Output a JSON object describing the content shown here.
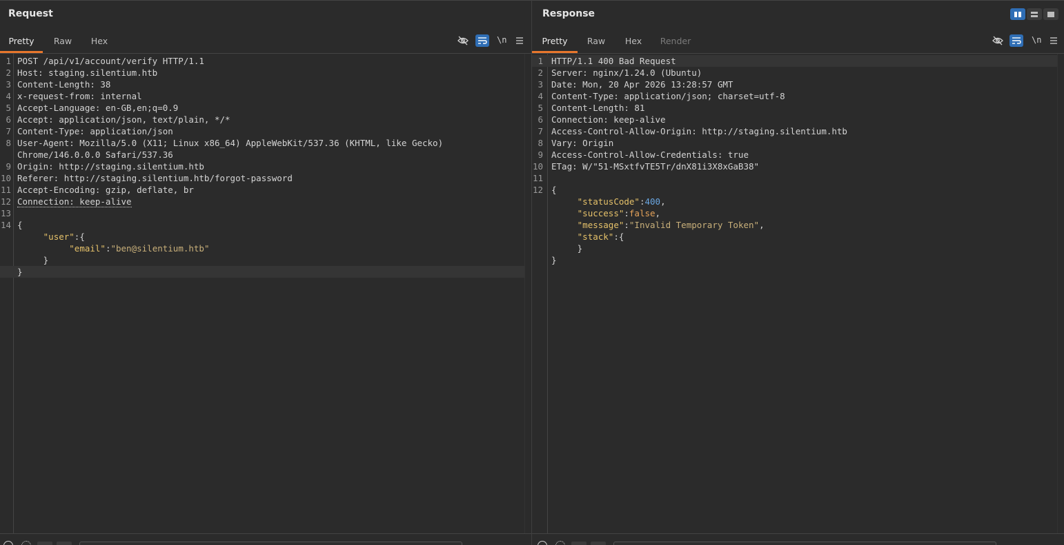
{
  "request": {
    "title": "Request",
    "tabs": [
      {
        "label": "Pretty",
        "active": true
      },
      {
        "label": "Raw",
        "active": false
      },
      {
        "label": "Hex",
        "active": false
      }
    ],
    "newline_label": "\\n",
    "lines": [
      {
        "n": "1",
        "segs": [
          {
            "t": "POST /api/v1/account/verify HTTP/1.1",
            "c": "hk"
          }
        ]
      },
      {
        "n": "2",
        "segs": [
          {
            "t": "Host: staging.silentium.htb",
            "c": "hk"
          }
        ]
      },
      {
        "n": "3",
        "segs": [
          {
            "t": "Content-Length: 38",
            "c": "hk"
          }
        ]
      },
      {
        "n": "4",
        "segs": [
          {
            "t": "x-request-from: internal",
            "c": "hk"
          }
        ]
      },
      {
        "n": "5",
        "segs": [
          {
            "t": "Accept-Language: en-GB,en;q=0.9",
            "c": "hk"
          }
        ]
      },
      {
        "n": "6",
        "segs": [
          {
            "t": "Accept: application/json, text/plain, */*",
            "c": "hk"
          }
        ]
      },
      {
        "n": "7",
        "segs": [
          {
            "t": "Content-Type: application/json",
            "c": "hk"
          }
        ]
      },
      {
        "n": "8",
        "segs": [
          {
            "t": "User-Agent: Mozilla/5.0 (X11; Linux x86_64) AppleWebKit/537.36 (KHTML, like Gecko)",
            "c": "hk"
          }
        ]
      },
      {
        "n": "",
        "segs": [
          {
            "t": "Chrome/146.0.0.0 Safari/537.36",
            "c": "hk"
          }
        ]
      },
      {
        "n": "9",
        "segs": [
          {
            "t": "Origin: http://staging.silentium.htb",
            "c": "hk"
          }
        ]
      },
      {
        "n": "10",
        "segs": [
          {
            "t": "Referer: http://staging.silentium.htb/forgot-password",
            "c": "hk"
          }
        ]
      },
      {
        "n": "11",
        "segs": [
          {
            "t": "Accept-Encoding: gzip, deflate, br",
            "c": "hk"
          }
        ]
      },
      {
        "n": "12",
        "segs": [
          {
            "t": "Connection: keep-alive",
            "c": "hk dotted"
          }
        ]
      },
      {
        "n": "13",
        "segs": []
      },
      {
        "n": "14",
        "segs": [
          {
            "t": "{",
            "c": "hk"
          }
        ]
      },
      {
        "n": "",
        "segs": [
          {
            "t": "     ",
            "c": "hk"
          },
          {
            "t": "\"user\"",
            "c": "jk"
          },
          {
            "t": ":{",
            "c": "hk"
          }
        ]
      },
      {
        "n": "",
        "segs": [
          {
            "t": "          ",
            "c": "hk"
          },
          {
            "t": "\"email\"",
            "c": "jk"
          },
          {
            "t": ":",
            "c": "hk"
          },
          {
            "t": "\"ben@silentium.htb\"",
            "c": "js"
          }
        ]
      },
      {
        "n": "",
        "segs": [
          {
            "t": "     }",
            "c": "hk"
          }
        ]
      },
      {
        "n": "",
        "segs": [
          {
            "t": "}",
            "c": "hk"
          }
        ],
        "hl": true
      }
    ]
  },
  "response": {
    "title": "Response",
    "tabs": [
      {
        "label": "Pretty",
        "active": true
      },
      {
        "label": "Raw",
        "active": false
      },
      {
        "label": "Hex",
        "active": false
      },
      {
        "label": "Render",
        "active": false,
        "disabled": true
      }
    ],
    "newline_label": "\\n",
    "lines": [
      {
        "n": "1",
        "segs": [
          {
            "t": "HTTP/1.1 400 Bad Request",
            "c": "hk"
          }
        ],
        "hl": true
      },
      {
        "n": "2",
        "segs": [
          {
            "t": "Server: nginx/1.24.0 (Ubuntu)",
            "c": "hk"
          }
        ]
      },
      {
        "n": "3",
        "segs": [
          {
            "t": "Date: Mon, 20 Apr 2026 13:28:57 GMT",
            "c": "hk"
          }
        ]
      },
      {
        "n": "4",
        "segs": [
          {
            "t": "Content-Type: application/json; charset=utf-8",
            "c": "hk"
          }
        ]
      },
      {
        "n": "5",
        "segs": [
          {
            "t": "Content-Length: 81",
            "c": "hk"
          }
        ]
      },
      {
        "n": "6",
        "segs": [
          {
            "t": "Connection: keep-alive",
            "c": "hk"
          }
        ]
      },
      {
        "n": "7",
        "segs": [
          {
            "t": "Access-Control-Allow-Origin: http://staging.silentium.htb",
            "c": "hk"
          }
        ]
      },
      {
        "n": "8",
        "segs": [
          {
            "t": "Vary: Origin",
            "c": "hk"
          }
        ]
      },
      {
        "n": "9",
        "segs": [
          {
            "t": "Access-Control-Allow-Credentials: true",
            "c": "hk"
          }
        ]
      },
      {
        "n": "10",
        "segs": [
          {
            "t": "ETag: W/\"51-MSxtfvTE5Tr/dnX81i3X8xGaB38\"",
            "c": "hk"
          }
        ]
      },
      {
        "n": "11",
        "segs": []
      },
      {
        "n": "12",
        "segs": [
          {
            "t": "{",
            "c": "hk"
          }
        ]
      },
      {
        "n": "",
        "segs": [
          {
            "t": "     ",
            "c": "hk"
          },
          {
            "t": "\"statusCode\"",
            "c": "jk"
          },
          {
            "t": ":",
            "c": "hk"
          },
          {
            "t": "400",
            "c": "jn"
          },
          {
            "t": ",",
            "c": "hk"
          }
        ]
      },
      {
        "n": "",
        "segs": [
          {
            "t": "     ",
            "c": "hk"
          },
          {
            "t": "\"success\"",
            "c": "jk"
          },
          {
            "t": ":",
            "c": "hk"
          },
          {
            "t": "false",
            "c": "jb"
          },
          {
            "t": ",",
            "c": "hk"
          }
        ]
      },
      {
        "n": "",
        "segs": [
          {
            "t": "     ",
            "c": "hk"
          },
          {
            "t": "\"message\"",
            "c": "jk"
          },
          {
            "t": ":",
            "c": "hk"
          },
          {
            "t": "\"Invalid Temporary Token\"",
            "c": "js"
          },
          {
            "t": ",",
            "c": "hk"
          }
        ]
      },
      {
        "n": "",
        "segs": [
          {
            "t": "     ",
            "c": "hk"
          },
          {
            "t": "\"stack\"",
            "c": "jk"
          },
          {
            "t": ":{",
            "c": "hk"
          }
        ]
      },
      {
        "n": "",
        "segs": [
          {
            "t": "     }",
            "c": "hk"
          }
        ]
      },
      {
        "n": "",
        "segs": [
          {
            "t": "}",
            "c": "hk"
          }
        ]
      }
    ]
  },
  "colors": {
    "accent_tab": "#e8762c",
    "toggle_on": "#2f6eb5",
    "json_key": "#e6c26a",
    "json_string": "#c9b07a",
    "json_number": "#6aa7e3",
    "json_bool": "#e6a35a"
  },
  "icons": [
    "eye-off-icon",
    "wrap-icon",
    "newline-icon",
    "hamburger-menu-icon",
    "layout-columns-icon",
    "layout-rows-icon",
    "layout-single-icon"
  ]
}
